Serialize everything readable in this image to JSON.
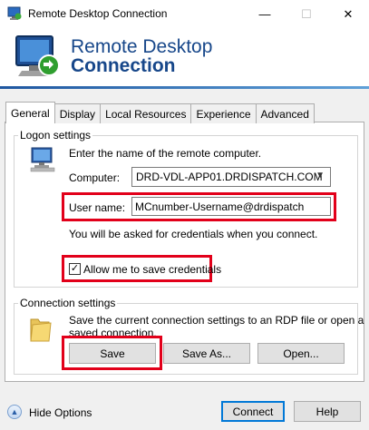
{
  "window": {
    "title": "Remote Desktop Connection",
    "minimize_glyph": "—",
    "maximize_glyph": "☐",
    "close_glyph": "✕"
  },
  "banner": {
    "line1": "Remote Desktop",
    "line2": "Connection"
  },
  "tabs": [
    {
      "label": "General",
      "active": true
    },
    {
      "label": "Display",
      "active": false
    },
    {
      "label": "Local Resources",
      "active": false
    },
    {
      "label": "Experience",
      "active": false
    },
    {
      "label": "Advanced",
      "active": false
    }
  ],
  "logon": {
    "group_label": "Logon settings",
    "instruction": "Enter the name of the remote computer.",
    "computer_label": "Computer:",
    "computer_value": "DRD-VDL-APP01.DRDISPATCH.COM",
    "username_label": "User name:",
    "username_value": "MCnumber-Username@drdispatch",
    "credentials_note": "You will be asked for credentials when you connect.",
    "save_credentials_label": "Allow me to save credentials",
    "save_credentials_checked": true
  },
  "connection": {
    "group_label": "Connection settings",
    "description_line1": "Save the current connection settings to an RDP file or open a",
    "description_line2": "saved connection.",
    "save_label": "Save",
    "save_as_label": "Save As...",
    "open_label": "Open..."
  },
  "footer": {
    "hide_options_label": "Hide Options",
    "connect_label": "Connect",
    "help_label": "Help"
  },
  "colors": {
    "highlight": "#e2001a",
    "banner_text": "#17478a",
    "accent": "#0078d7"
  }
}
